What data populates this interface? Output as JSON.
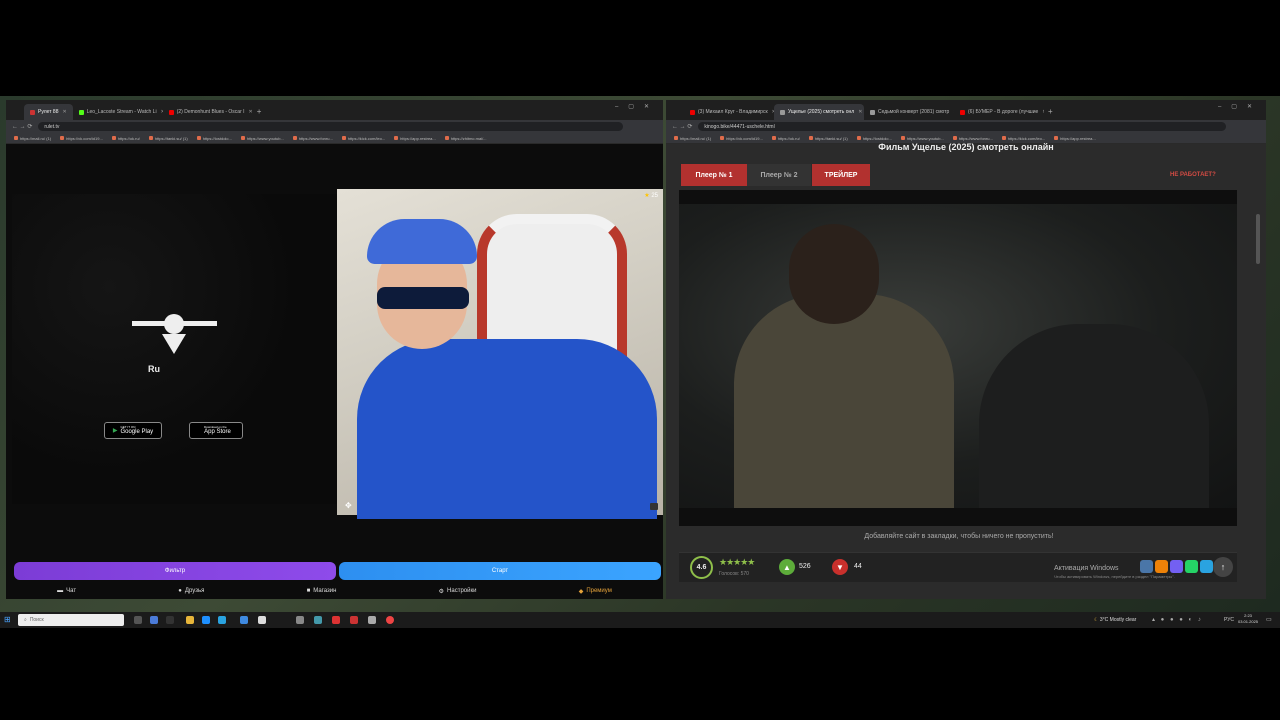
{
  "left_window": {
    "tabs": [
      {
        "label": "Рулет 88",
        "active": true
      },
      {
        "label": "Leo_Lacoste Stream - Watch Li",
        "active": false
      },
      {
        "label": "(2) Demonhunt Blues - Oscar I",
        "active": false
      }
    ],
    "url": "rulet.tv",
    "bookmarks": [
      "https://mail.ru/ (1)",
      "https://vk.com/id19...",
      "https://ok.ru/",
      "https://tanki.su/ (1)",
      "https://lostdolo...",
      "https://www.youtub...",
      "https://www.fonru...",
      "https://kick.com/leo...",
      "https://app.restrea...",
      "https://zhitmo.mai/..."
    ],
    "logo_text": "Ru",
    "google_play": "Google Play",
    "google_play_small": "GET IT ON",
    "app_store": "App Store",
    "app_store_small": "Download on the",
    "viewer_count": "25",
    "btn_left": "Фильтр",
    "btn_right": "Старт",
    "nav": [
      "Чат",
      "Друзья",
      "Магазин",
      "Настройки",
      "Премиум"
    ]
  },
  "right_window": {
    "tabs": [
      {
        "label": "(3) Михаил Круг - Владимирск",
        "active": false
      },
      {
        "label": "Ущелье (2025) смотреть онл",
        "active": true
      },
      {
        "label": "Седьмой конверт (2081) смотр",
        "active": false
      },
      {
        "label": "(6) БУМЕР - В дороге (лучшие",
        "active": false
      }
    ],
    "url": "kinogo.bike/44471-uschele.html",
    "bookmarks": [
      "https://mail.ru/ (1)",
      "https://vk.com/id19...",
      "https://ok.ru/",
      "https://tanki.su/ (1)",
      "https://lostdolo...",
      "https://www.youtub...",
      "https://www.fonru...",
      "https://kick.com/leo...",
      "https://app.restrea..."
    ],
    "title": "Фильм Ущелье (2025) смотреть онлайн",
    "player1": "Плеер № 1",
    "player2": "Плеер № 2",
    "trailer": "ТРЕЙЛЕР",
    "not_working": "НЕ РАБОТАЕТ?",
    "bookmark_note": "Добавляйте сайт в закладки, чтобы ничего не пропустить!",
    "rating": "4.6",
    "votes": "Голосов: 570",
    "likes": "526",
    "dislikes": "44",
    "activation_title": "Активация Windows",
    "activation_sub": "Чтобы активировать Windows, перейдите в раздел \"Параметры\"."
  },
  "taskbar": {
    "search": "Поиск",
    "weather": "3°C  Mostly clear",
    "lang": "РУС",
    "time": "2:23",
    "date": "03.01.2025"
  }
}
